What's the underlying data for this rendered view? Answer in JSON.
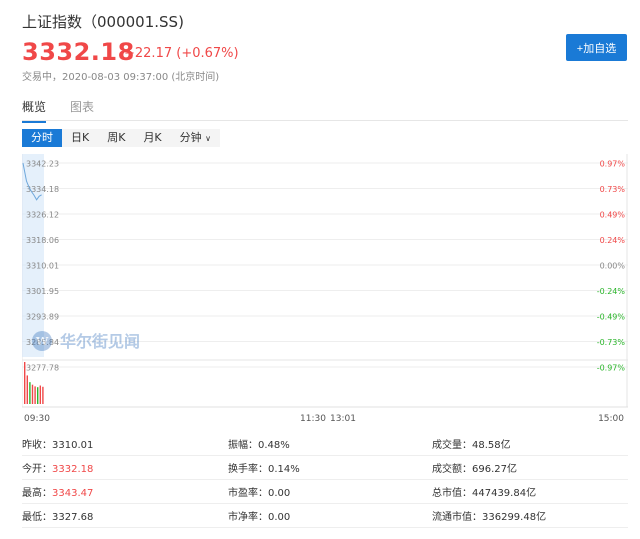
{
  "header": {
    "title": "上证指数（000001.SS)",
    "price": "3332.18",
    "change": "+22.17 (+0.67%)",
    "status": "交易中，2020-08-03 09:37:00 (北京时间)",
    "add_button": "+加自选"
  },
  "tabs": [
    {
      "label": "概览"
    },
    {
      "label": "图表"
    }
  ],
  "periods": [
    {
      "label": "分时"
    },
    {
      "label": "日K"
    },
    {
      "label": "周K"
    },
    {
      "label": "月K"
    },
    {
      "label": "分钟"
    }
  ],
  "watermark": "华尔街见闻",
  "colors": {
    "up": "#f04848",
    "down": "#2bb52b",
    "accent": "#1a7ad6"
  },
  "chart_data": {
    "type": "line",
    "y_ticks": [
      "3342.23",
      "3334.18",
      "3326.12",
      "3318.06",
      "3310.01",
      "3301.95",
      "3293.89",
      "3285.84",
      "3277.78"
    ],
    "pct_ticks": [
      "0.97%",
      "0.73%",
      "0.49%",
      "0.24%",
      "0.00%",
      "-0.24%",
      "-0.49%",
      "-0.73%",
      "-0.97%"
    ],
    "x_ticks": [
      "09:30",
      "11:30",
      "13:01",
      "15:00"
    ],
    "ylim": [
      3277.78,
      3342.23
    ],
    "minutes": [
      0,
      1,
      2,
      3,
      4,
      5,
      6,
      7
    ],
    "prices": [
      3342.2,
      3336.5,
      3334.6,
      3333.2,
      3332.0,
      3330.6,
      3331.7,
      3332.18
    ],
    "volumes": [
      1.0,
      0.68,
      0.52,
      0.46,
      0.42,
      0.4,
      0.44,
      0.41
    ]
  },
  "stats": [
    [
      {
        "label": "昨收：",
        "value": "3310.01"
      },
      {
        "label": "振幅：",
        "value": "0.48%"
      },
      {
        "label": "成交量：",
        "value": "48.58亿"
      }
    ],
    [
      {
        "label": "今开：",
        "value": "3332.18"
      },
      {
        "label": "换手率：",
        "value": "0.14%"
      },
      {
        "label": "成交额：",
        "value": "696.27亿"
      }
    ],
    [
      {
        "label": "最高：",
        "value": "3343.47"
      },
      {
        "label": "市盈率：",
        "value": "0.00"
      },
      {
        "label": "总市值：",
        "value": "447439.84亿"
      }
    ],
    [
      {
        "label": "最低：",
        "value": "3327.68"
      },
      {
        "label": "市净率：",
        "value": "0.00"
      },
      {
        "label": "流通市值：",
        "value": "336299.48亿"
      }
    ]
  ]
}
